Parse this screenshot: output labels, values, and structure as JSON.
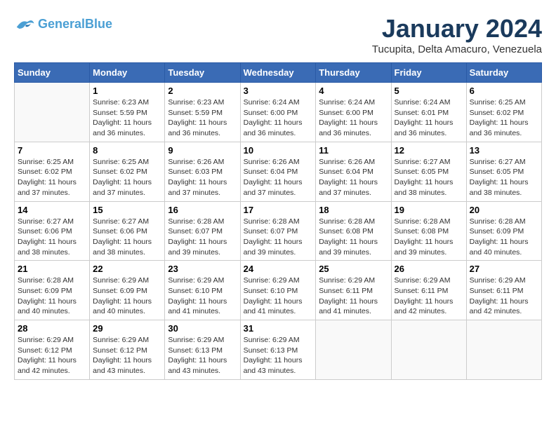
{
  "header": {
    "logo": {
      "line1": "General",
      "line2": "Blue"
    },
    "title": "January 2024",
    "location": "Tucupita, Delta Amacuro, Venezuela"
  },
  "weekdays": [
    "Sunday",
    "Monday",
    "Tuesday",
    "Wednesday",
    "Thursday",
    "Friday",
    "Saturday"
  ],
  "weeks": [
    [
      {
        "day": "",
        "sunrise": "",
        "sunset": "",
        "daylight": ""
      },
      {
        "day": "1",
        "sunrise": "6:23 AM",
        "sunset": "5:59 PM",
        "daylight": "11 hours and 36 minutes."
      },
      {
        "day": "2",
        "sunrise": "6:23 AM",
        "sunset": "5:59 PM",
        "daylight": "11 hours and 36 minutes."
      },
      {
        "day": "3",
        "sunrise": "6:24 AM",
        "sunset": "6:00 PM",
        "daylight": "11 hours and 36 minutes."
      },
      {
        "day": "4",
        "sunrise": "6:24 AM",
        "sunset": "6:00 PM",
        "daylight": "11 hours and 36 minutes."
      },
      {
        "day": "5",
        "sunrise": "6:24 AM",
        "sunset": "6:01 PM",
        "daylight": "11 hours and 36 minutes."
      },
      {
        "day": "6",
        "sunrise": "6:25 AM",
        "sunset": "6:02 PM",
        "daylight": "11 hours and 36 minutes."
      }
    ],
    [
      {
        "day": "7",
        "sunrise": "6:25 AM",
        "sunset": "6:02 PM",
        "daylight": "11 hours and 37 minutes."
      },
      {
        "day": "8",
        "sunrise": "6:25 AM",
        "sunset": "6:02 PM",
        "daylight": "11 hours and 37 minutes."
      },
      {
        "day": "9",
        "sunrise": "6:26 AM",
        "sunset": "6:03 PM",
        "daylight": "11 hours and 37 minutes."
      },
      {
        "day": "10",
        "sunrise": "6:26 AM",
        "sunset": "6:04 PM",
        "daylight": "11 hours and 37 minutes."
      },
      {
        "day": "11",
        "sunrise": "6:26 AM",
        "sunset": "6:04 PM",
        "daylight": "11 hours and 37 minutes."
      },
      {
        "day": "12",
        "sunrise": "6:27 AM",
        "sunset": "6:05 PM",
        "daylight": "11 hours and 38 minutes."
      },
      {
        "day": "13",
        "sunrise": "6:27 AM",
        "sunset": "6:05 PM",
        "daylight": "11 hours and 38 minutes."
      }
    ],
    [
      {
        "day": "14",
        "sunrise": "6:27 AM",
        "sunset": "6:06 PM",
        "daylight": "11 hours and 38 minutes."
      },
      {
        "day": "15",
        "sunrise": "6:27 AM",
        "sunset": "6:06 PM",
        "daylight": "11 hours and 38 minutes."
      },
      {
        "day": "16",
        "sunrise": "6:28 AM",
        "sunset": "6:07 PM",
        "daylight": "11 hours and 39 minutes."
      },
      {
        "day": "17",
        "sunrise": "6:28 AM",
        "sunset": "6:07 PM",
        "daylight": "11 hours and 39 minutes."
      },
      {
        "day": "18",
        "sunrise": "6:28 AM",
        "sunset": "6:08 PM",
        "daylight": "11 hours and 39 minutes."
      },
      {
        "day": "19",
        "sunrise": "6:28 AM",
        "sunset": "6:08 PM",
        "daylight": "11 hours and 39 minutes."
      },
      {
        "day": "20",
        "sunrise": "6:28 AM",
        "sunset": "6:09 PM",
        "daylight": "11 hours and 40 minutes."
      }
    ],
    [
      {
        "day": "21",
        "sunrise": "6:28 AM",
        "sunset": "6:09 PM",
        "daylight": "11 hours and 40 minutes."
      },
      {
        "day": "22",
        "sunrise": "6:29 AM",
        "sunset": "6:09 PM",
        "daylight": "11 hours and 40 minutes."
      },
      {
        "day": "23",
        "sunrise": "6:29 AM",
        "sunset": "6:10 PM",
        "daylight": "11 hours and 41 minutes."
      },
      {
        "day": "24",
        "sunrise": "6:29 AM",
        "sunset": "6:10 PM",
        "daylight": "11 hours and 41 minutes."
      },
      {
        "day": "25",
        "sunrise": "6:29 AM",
        "sunset": "6:11 PM",
        "daylight": "11 hours and 41 minutes."
      },
      {
        "day": "26",
        "sunrise": "6:29 AM",
        "sunset": "6:11 PM",
        "daylight": "11 hours and 42 minutes."
      },
      {
        "day": "27",
        "sunrise": "6:29 AM",
        "sunset": "6:11 PM",
        "daylight": "11 hours and 42 minutes."
      }
    ],
    [
      {
        "day": "28",
        "sunrise": "6:29 AM",
        "sunset": "6:12 PM",
        "daylight": "11 hours and 42 minutes."
      },
      {
        "day": "29",
        "sunrise": "6:29 AM",
        "sunset": "6:12 PM",
        "daylight": "11 hours and 43 minutes."
      },
      {
        "day": "30",
        "sunrise": "6:29 AM",
        "sunset": "6:13 PM",
        "daylight": "11 hours and 43 minutes."
      },
      {
        "day": "31",
        "sunrise": "6:29 AM",
        "sunset": "6:13 PM",
        "daylight": "11 hours and 43 minutes."
      },
      {
        "day": "",
        "sunrise": "",
        "sunset": "",
        "daylight": ""
      },
      {
        "day": "",
        "sunrise": "",
        "sunset": "",
        "daylight": ""
      },
      {
        "day": "",
        "sunrise": "",
        "sunset": "",
        "daylight": ""
      }
    ]
  ],
  "labels": {
    "sunrise": "Sunrise:",
    "sunset": "Sunset:",
    "daylight": "Daylight:"
  }
}
